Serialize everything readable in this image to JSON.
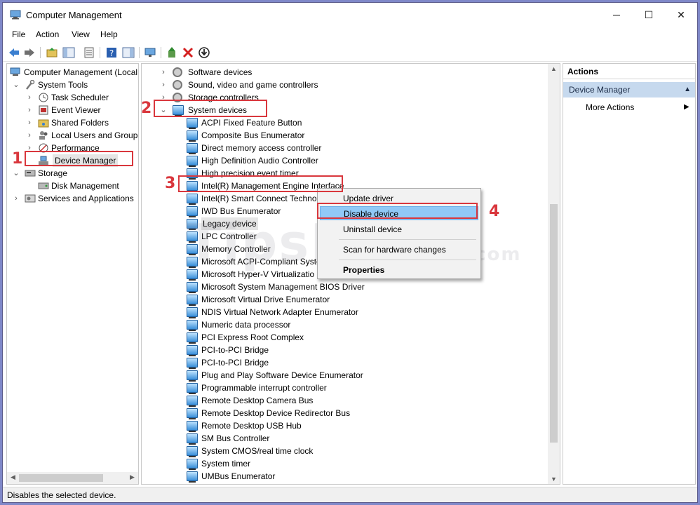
{
  "window": {
    "title": "Computer Management",
    "minimize": "─",
    "maximize": "☐",
    "close": "✕"
  },
  "menu": [
    "File",
    "Action",
    "View",
    "Help"
  ],
  "left_tree": [
    {
      "label": "Computer Management (Local",
      "expander": "",
      "level": 0
    },
    {
      "label": "System Tools",
      "expander": "v",
      "level": 1
    },
    {
      "label": "Task Scheduler",
      "expander": ">",
      "level": 2
    },
    {
      "label": "Event Viewer",
      "expander": ">",
      "level": 2
    },
    {
      "label": "Shared Folders",
      "expander": ">",
      "level": 2
    },
    {
      "label": "Local Users and Groups",
      "expander": ">",
      "level": 2
    },
    {
      "label": "Performance",
      "expander": ">",
      "level": 2
    },
    {
      "label": "Device Manager",
      "expander": "",
      "level": 2
    },
    {
      "label": "Storage",
      "expander": "v",
      "level": 1
    },
    {
      "label": "Disk Management",
      "expander": "",
      "level": 2
    },
    {
      "label": "Services and Applications",
      "expander": ">",
      "level": 1
    }
  ],
  "device_categories": [
    {
      "label": "Software devices",
      "expander": ">"
    },
    {
      "label": "Sound, video and game controllers",
      "expander": ">"
    },
    {
      "label": "Storage controllers",
      "expander": ">"
    },
    {
      "label": "System devices",
      "expander": "v"
    }
  ],
  "system_devices": [
    "ACPI Fixed Feature Button",
    "Composite Bus Enumerator",
    "Direct memory access controller",
    "High Definition Audio Controller",
    "High precision event timer",
    "Intel(R) Management Engine Interface",
    "Intel(R) Smart Connect Technolo",
    "IWD Bus Enumerator",
    "Legacy device",
    "LPC Controller",
    "Memory Controller",
    "Microsoft ACPI-Compliant Syste",
    "Microsoft Hyper-V Virtualizatio",
    "Microsoft System Management BIOS Driver",
    "Microsoft Virtual Drive Enumerator",
    "NDIS Virtual Network Adapter Enumerator",
    "Numeric data processor",
    "PCI Express Root Complex",
    "PCI-to-PCI Bridge",
    "PCI-to-PCI Bridge",
    "Plug and Play Software Device Enumerator",
    "Programmable interrupt controller",
    "Remote Desktop Camera Bus",
    "Remote Desktop Device Redirector Bus",
    "Remote Desktop USB Hub",
    "SM Bus Controller",
    "System CMOS/real time clock",
    "System timer",
    "UMBus Enumerator"
  ],
  "context_menu": {
    "update": "Update driver",
    "disable": "Disable device",
    "uninstall": "Uninstall device",
    "scan": "Scan for hardware changes",
    "properties": "Properties"
  },
  "actions": {
    "header": "Actions",
    "section": "Device Manager",
    "more": "More Actions"
  },
  "status": "Disables the selected device.",
  "annotations": [
    "1",
    "2",
    "3",
    "4"
  ],
  "watermark": "TipsMake",
  "watermark_suffix": ".com",
  "colors": {
    "annotation": "#d9373d",
    "highlight": "#91c9f7",
    "actions_section": "#c6d9ee"
  }
}
